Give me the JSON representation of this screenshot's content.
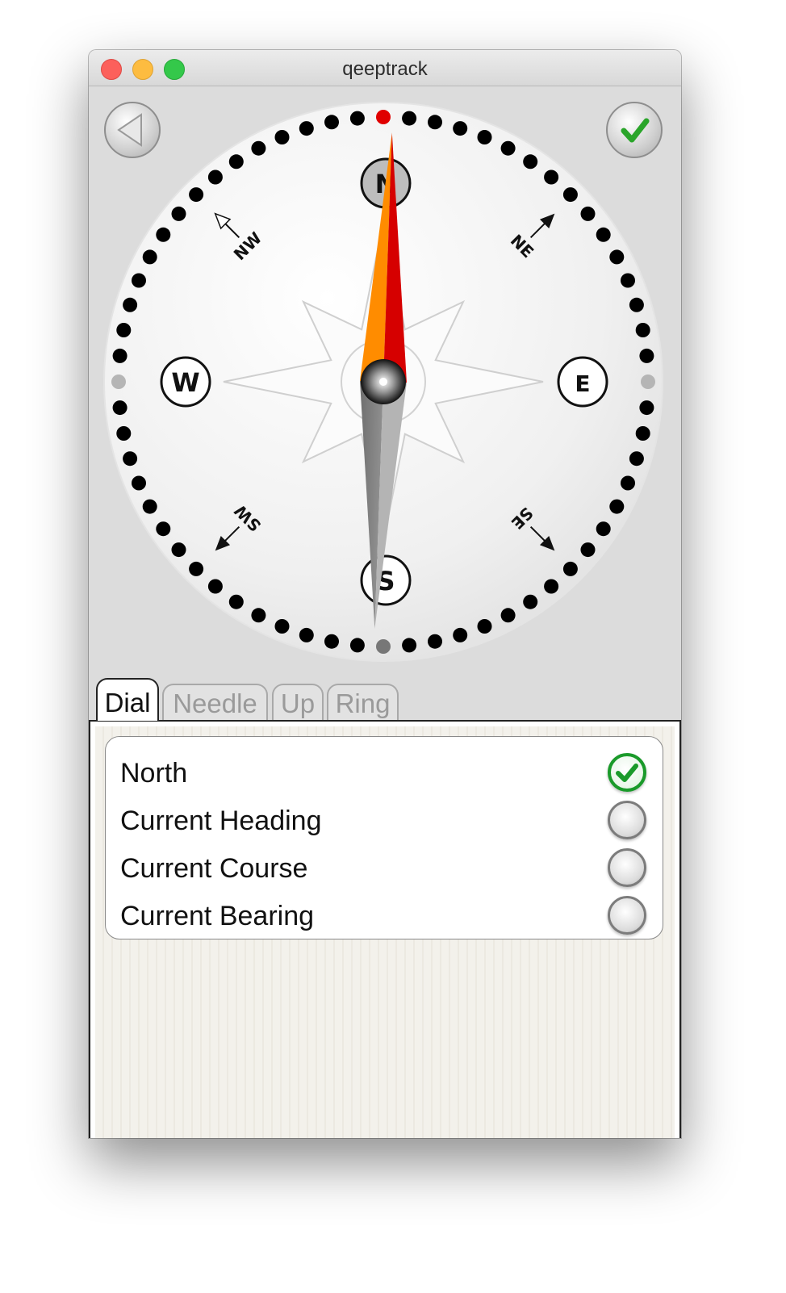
{
  "window": {
    "title": "qeeptrack"
  },
  "compass": {
    "directions": {
      "n": "N",
      "e": "E",
      "s": "S",
      "w": "W",
      "ne": "NE",
      "nw": "NW",
      "se": "SE",
      "sw": "SW"
    },
    "needle_heading_deg": 2,
    "colors": {
      "north_mark": "#e00000",
      "needle_orange": "#ff8c00",
      "needle_red": "#d60000"
    }
  },
  "toolbar": {
    "back_icon": "back-triangle-icon",
    "ok_icon": "checkmark-icon"
  },
  "tabs": [
    {
      "label": "Dial",
      "active": true
    },
    {
      "label": "Needle",
      "active": false
    },
    {
      "label": "Up",
      "active": false
    },
    {
      "label": "Ring",
      "active": false
    }
  ],
  "options": [
    {
      "label": "North",
      "checked": true
    },
    {
      "label": "Current Heading",
      "checked": false
    },
    {
      "label": "Current Course",
      "checked": false
    },
    {
      "label": "Current Bearing",
      "checked": false
    }
  ]
}
